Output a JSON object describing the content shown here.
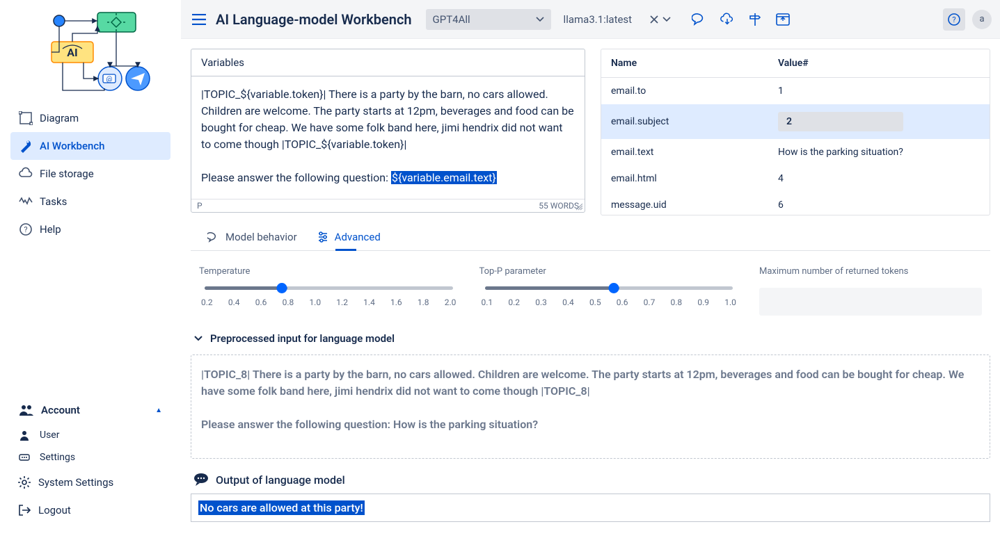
{
  "header": {
    "title": "AI Language-model Workbench",
    "provider": "GPT4All",
    "model": "llama3.1:latest",
    "avatar": "a"
  },
  "sidebar": {
    "items": [
      "Diagram",
      "AI Workbench",
      "File storage",
      "Tasks",
      "Help"
    ],
    "account": {
      "label": "Account",
      "items": [
        "User",
        "Settings",
        "System Settings",
        "Logout"
      ]
    }
  },
  "editor": {
    "header": "Variables",
    "body_pre": "|TOPIC_${variable.token}| There is a party by the barn, no cars allowed. Children are welcome. The party starts at 12pm, beverages and food can be bought for cheap. We have some folk band here, jimi hendrix did not want to come though |TOPIC_${variable.token}|",
    "body_q_prefix": "Please answer the following question: ",
    "body_q_var": "${variable.email.text}",
    "status_left": "P",
    "status_right": "55 WORDS"
  },
  "vars_table": {
    "col1": "Name",
    "col2": "Value#",
    "rows": [
      {
        "name": "email.to",
        "value": "1"
      },
      {
        "name": "email.subject",
        "value": "2"
      },
      {
        "name": "email.text",
        "value": "How is the parking situation?"
      },
      {
        "name": "email.html",
        "value": "4"
      },
      {
        "name": "message.uid",
        "value": "6"
      }
    ]
  },
  "tabs": {
    "behavior": "Model behavior",
    "advanced": "Advanced"
  },
  "params": {
    "temp_label": "Temperature",
    "temp_ticks": [
      "0.2",
      "0.4",
      "0.6",
      "0.8",
      "1.0",
      "1.2",
      "1.4",
      "1.6",
      "1.8",
      "2.0"
    ],
    "temp_value": 0.7,
    "topp_label": "Top-P parameter",
    "topp_ticks": [
      "0.1",
      "0.2",
      "0.3",
      "0.4",
      "0.5",
      "0.6",
      "0.7",
      "0.8",
      "0.9",
      "1.0"
    ],
    "topp_value": 0.55,
    "maxtok_label": "Maximum number of returned tokens"
  },
  "pre": {
    "header": "Preprocessed input for language model",
    "body1": "|TOPIC_8| There is a party by the barn, no cars allowed. Children are welcome. The party starts at 12pm, beverages and food can be bought for cheap. We have some folk band here, jimi hendrix did not want to come though |TOPIC_8|",
    "body2": "Please answer the following question: How is the parking situation?"
  },
  "output": {
    "header": "Output of language model",
    "text": "No cars are allowed at this party!"
  }
}
